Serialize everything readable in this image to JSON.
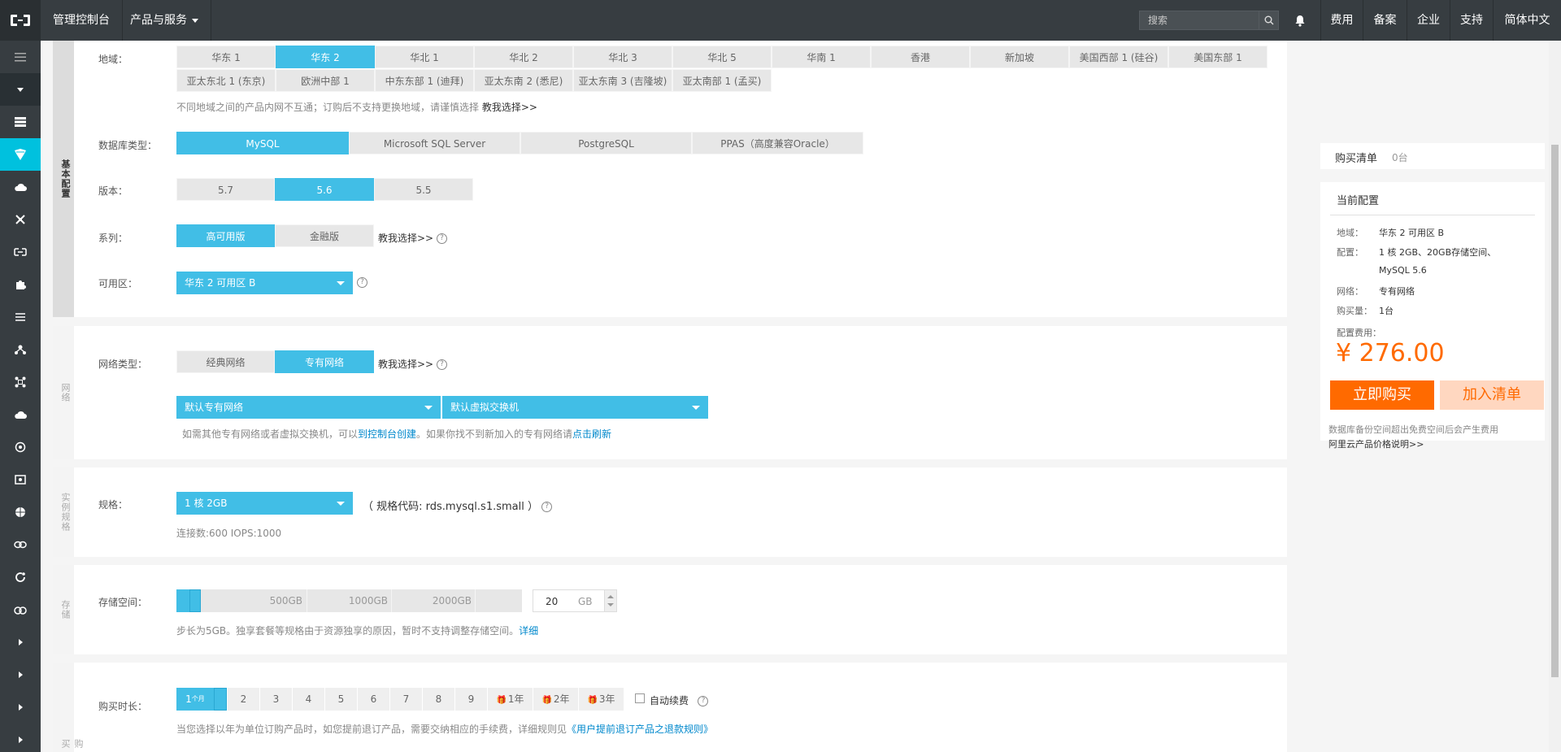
{
  "topbar": {
    "title": "管理控制台",
    "products": "产品与服务",
    "search_placeholder": "搜索",
    "nav": [
      "费用",
      "备案",
      "企业",
      "支持",
      "简体中文"
    ]
  },
  "sidebar": {
    "icons": [
      "menu-icon",
      "collapse-icon",
      "database-stack-icon",
      "rds-icon",
      "cloud-icon",
      "network-icon",
      "link-icon",
      "puzzle-icon",
      "list-icon",
      "tree-icon",
      "nodes-icon",
      "cloud-upload-icon",
      "eye-icon",
      "box-icon",
      "globe-icon",
      "chain-icon",
      "refresh-icon",
      "cloud-group-icon",
      "expand-icon",
      "expand-icon",
      "expand-icon",
      "expand-icon"
    ]
  },
  "basic": {
    "tab": "基本配置",
    "region_label": "地域：",
    "regions_row1": [
      "华东 1",
      "华东 2",
      "华北 1",
      "华北 2",
      "华北 3",
      "华北 5",
      "华南 1",
      "香港",
      "新加坡",
      "美国西部 1 (硅谷)",
      "美国东部 1"
    ],
    "regions_row2": [
      "亚太东北 1 (东京)",
      "欧洲中部 1",
      "中东东部 1 (迪拜)",
      "亚太东南 2 (悉尼)",
      "亚太东南 3 (吉隆坡)",
      "亚太南部 1 (孟买)"
    ],
    "region_selected": "华东 2",
    "region_hint": "不同地域之间的产品内网不互通；订购后不支持更换地域，请谨慎选择",
    "region_help": "教我选择>>",
    "db_label": "数据库类型：",
    "db_types": [
      "MySQL",
      "Microsoft SQL Server",
      "PostgreSQL",
      "PPAS（高度兼容Oracle）"
    ],
    "version_label": "版本：",
    "versions": [
      "5.7",
      "5.6",
      "5.5"
    ],
    "series_label": "系列：",
    "series": [
      "高可用版",
      "金融版"
    ],
    "series_help": "教我选择>>",
    "zone_label": "可用区：",
    "zone_value": "华东 2 可用区 B"
  },
  "network": {
    "tab": "网络",
    "type_label": "网络类型：",
    "types": [
      "经典网络",
      "专有网络"
    ],
    "help": "教我选择>>",
    "vpc": "默认专有网络",
    "vswitch": "默认虚拟交换机",
    "hint_a": "如需其他专有网络或者虚拟交换机，可以",
    "hint_link1": "到控制台创建",
    "hint_b": "。如果你找不到新加入的专有网络请",
    "hint_link2": "点击刷新"
  },
  "spec": {
    "tab": "实例规格",
    "label": "规格：",
    "value": "1 核 2GB",
    "code": "（ 规格代码: rds.mysql.s1.small ）",
    "conn": "连接数:600 IOPS:1000"
  },
  "storage": {
    "tab": "存储",
    "label": "存储空间：",
    "marks": [
      "500GB",
      "1000GB",
      "2000GB"
    ],
    "value": "20",
    "unit": "GB",
    "hint": "步长为5GB。独享套餐等规格由于资源独享的原因，暂时不支持调整存储空间。",
    "hint_link": "详细"
  },
  "purchase": {
    "tab": "购买",
    "label": "购买时长：",
    "first": "1",
    "first_unit": "个月",
    "months": [
      "2",
      "3",
      "4",
      "5",
      "6",
      "7",
      "8",
      "9"
    ],
    "years": [
      "1年",
      "2年",
      "3年"
    ],
    "auto_renew": "自动续费",
    "hint": "当您选择以年为单位订购产品时，如您提前退订产品，需要交纳相应的手续费，详细规则见",
    "hint_link": "《用户提前退订产品之退款规则》"
  },
  "cart": {
    "title": "购买清单",
    "count": "0台"
  },
  "config": {
    "title": "当前配置",
    "rows": [
      {
        "k": "地域：",
        "v": "华东 2 可用区 B"
      },
      {
        "k": "配置：",
        "v": "1 核 2GB、20GB存储空间、"
      },
      {
        "k": "",
        "v": "MySQL 5.6"
      },
      {
        "k": "网络：",
        "v": "专有网络"
      },
      {
        "k": "购买量：",
        "v": "1台"
      }
    ],
    "fee_label": "配置费用：",
    "price": "¥ 276.00",
    "buy": "立即购买",
    "add": "加入清单",
    "note1": "数据库备份空间超出免费空间后会产生费用",
    "note2": "阿里云产品价格说明>>"
  },
  "colors": {
    "accent": "#41bee6",
    "orange": "#ff6a00",
    "dark": "#373d41"
  }
}
